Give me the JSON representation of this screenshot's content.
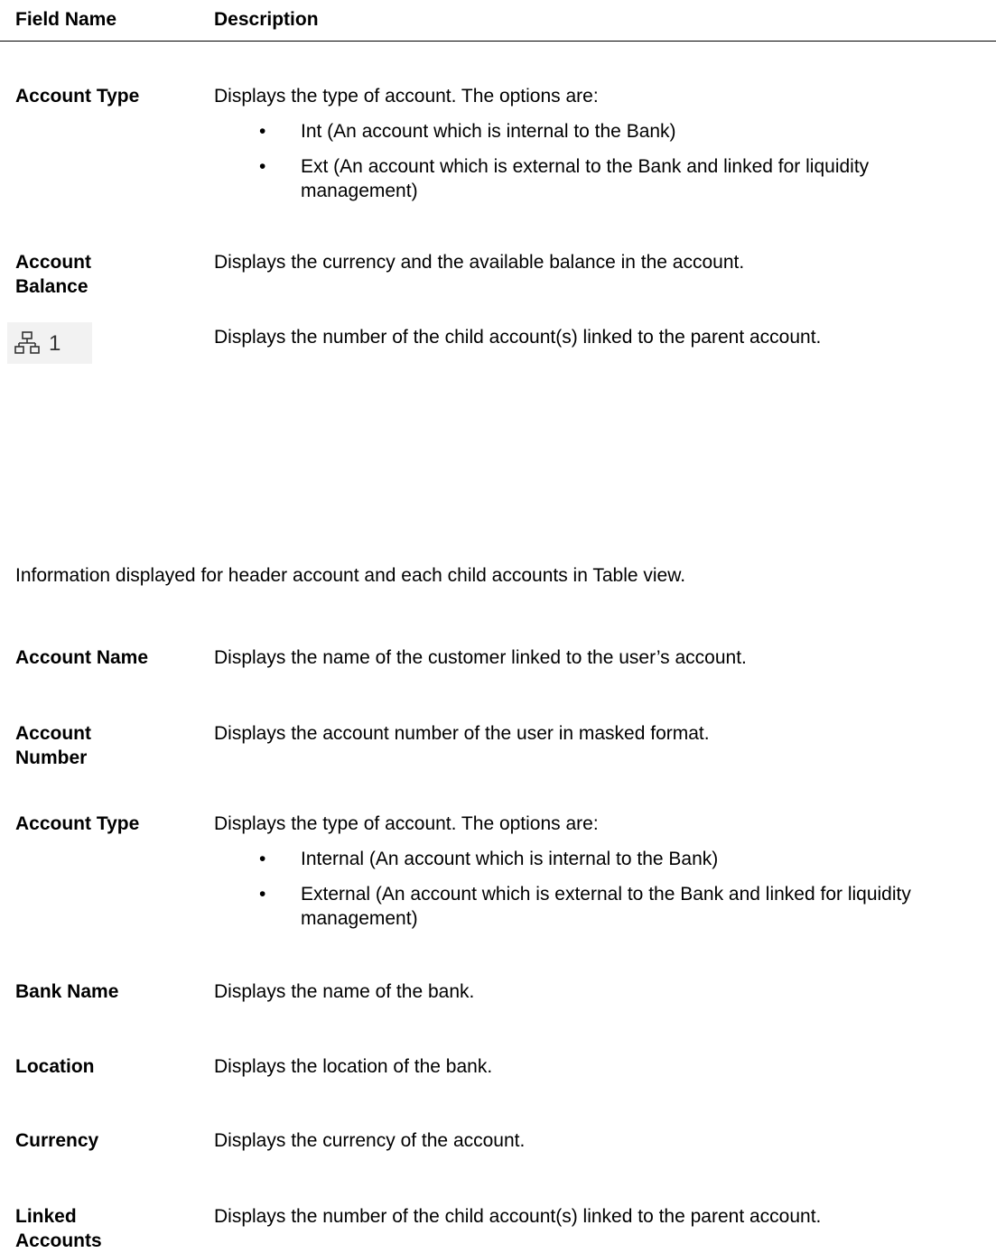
{
  "header": {
    "field_name": "Field Name",
    "description": "Description"
  },
  "section1": {
    "account_type": {
      "name": "Account Type",
      "desc": "Displays the type of account. The options are:",
      "options": [
        "Int (An account which is internal to the Bank)",
        "Ext (An account which is external to the Bank and linked for liquidity management)"
      ]
    },
    "account_balance": {
      "name": "Account Balance",
      "desc": "Displays the currency and the available balance in the account."
    },
    "linked_icon_row": {
      "icon": "hierarchy-icon",
      "count": "1",
      "desc": "Displays the number of the child account(s) linked to the parent account."
    }
  },
  "note": "Information displayed for header account and each child accounts in Table view.",
  "section2": {
    "account_name": {
      "name": "Account Name",
      "desc": "Displays the name of the customer linked to the user’s account."
    },
    "account_number": {
      "name": "Account Number",
      "desc": "Displays the account number of the user in masked format."
    },
    "account_type": {
      "name": "Account Type",
      "desc": "Displays the type of account. The options are:",
      "options": [
        "Internal (An account which is internal to the Bank)",
        "External (An account which is external to the Bank and linked for liquidity management)"
      ]
    },
    "bank_name": {
      "name": "Bank Name",
      "desc": "Displays the name of the bank."
    },
    "location": {
      "name": "Location",
      "desc": "Displays the location of the bank."
    },
    "currency": {
      "name": "Currency",
      "desc": "Displays the currency of the account."
    },
    "linked_accounts": {
      "name": "Linked Accounts",
      "desc": "Displays the number of the child account(s) linked to the parent account."
    }
  }
}
